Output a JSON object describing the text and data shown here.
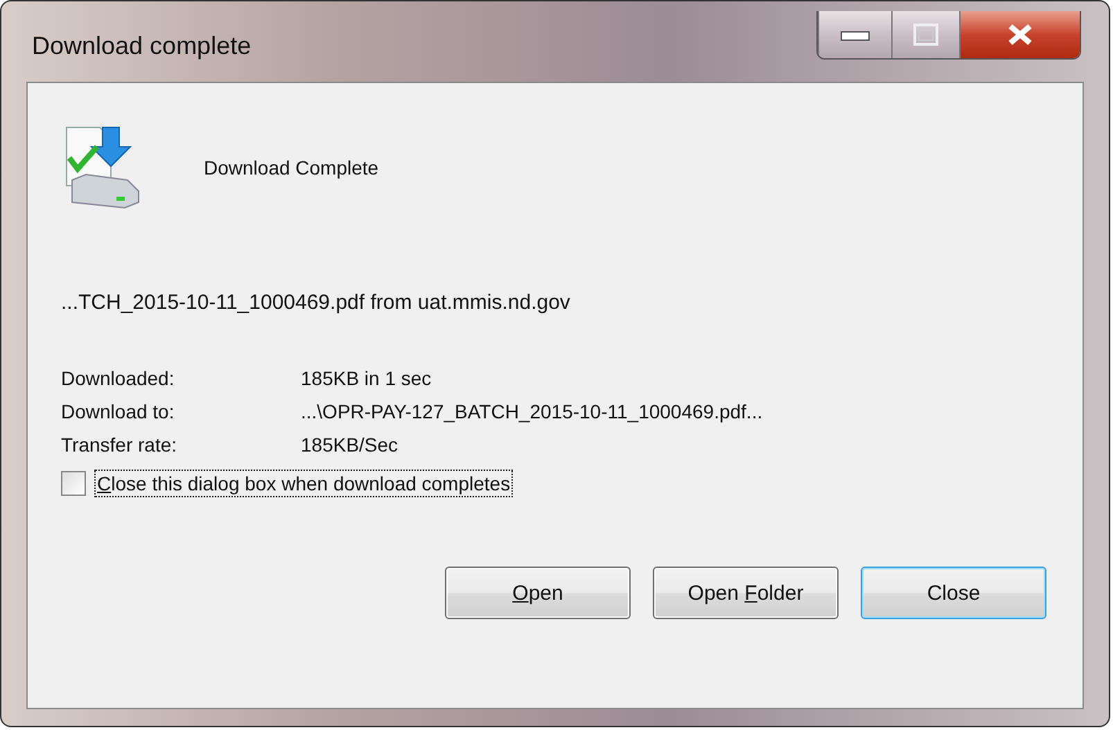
{
  "window": {
    "title": "Download complete"
  },
  "caption_buttons": [
    {
      "kind": "minimize"
    },
    {
      "kind": "maximize"
    },
    {
      "kind": "close"
    }
  ],
  "heading": "Download Complete",
  "file_line": "...TCH_2015-10-11_1000469.pdf from uat.mmis.nd.gov",
  "details": [
    {
      "label": "Downloaded:",
      "value": "185KB in 1 sec"
    },
    {
      "label": "Download to:",
      "value": "...\\OPR-PAY-127_BATCH_2015-10-11_1000469.pdf..."
    },
    {
      "label": "Transfer rate:",
      "value": "185KB/Sec"
    }
  ],
  "close_checkbox": {
    "access_key": "C",
    "label_after": "lose this dialog box when download completes",
    "checked": false,
    "focused": true
  },
  "buttons": [
    {
      "access_key": "O",
      "label_after": "pen",
      "default": false
    },
    {
      "label_before": "Open ",
      "access_key": "F",
      "label_after": "older",
      "default": false
    },
    {
      "label_before": "Close",
      "default": true
    }
  ]
}
